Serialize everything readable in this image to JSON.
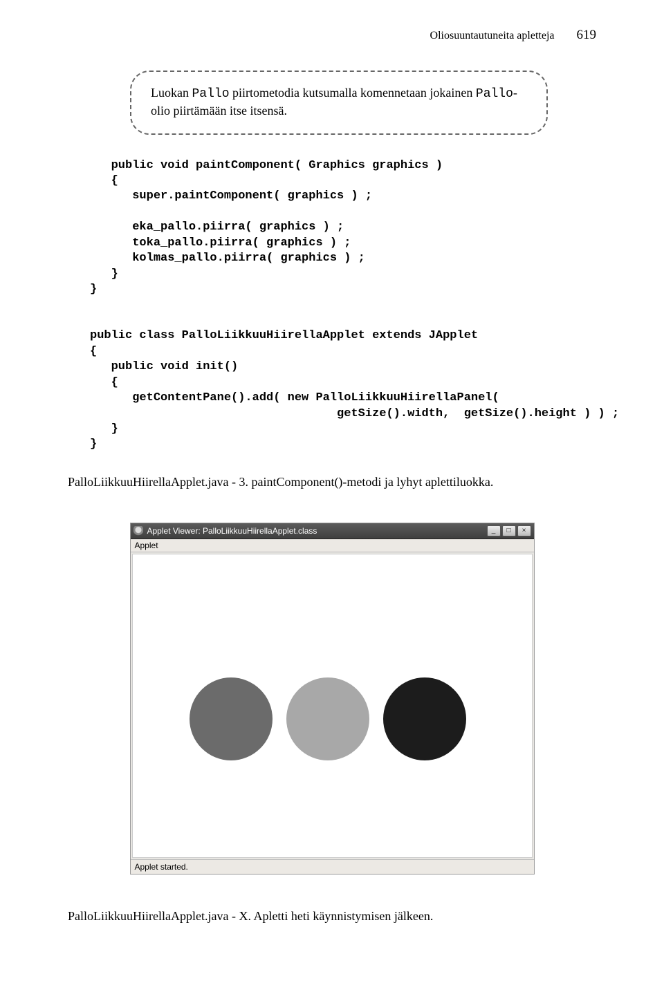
{
  "header": {
    "running_title": "Oliosuuntautuneita apletteja",
    "page_number": "619"
  },
  "callout": {
    "prefix": "Luokan ",
    "code1": "Pallo",
    "mid1": " piirtometodia kutsumalla komennetaan jokainen ",
    "code2": "Pallo",
    "suffix": "-olio piirtämään itse itsensä."
  },
  "code1": "   public void paintComponent( Graphics graphics )\n   {\n      super.paintComponent( graphics ) ;\n\n      eka_pallo.piirra( graphics ) ;\n      toka_pallo.piirra( graphics ) ;\n      kolmas_pallo.piirra( graphics ) ;\n   }\n}\n\n\npublic class PalloLiikkuuHiirellaApplet extends JApplet\n{\n   public void init()\n   {\n      getContentPane().add( new PalloLiikkuuHiirellaPanel(\n                                   getSize().width,  getSize().height ) ) ;\n   }\n}",
  "caption1": {
    "filename": "PalloLiikkuuHiirellaApplet.java - 3.",
    "desc": "  paintComponent()-metodi ja lyhyt aplettiluokka."
  },
  "applet": {
    "title": "Applet Viewer: PalloLiikkuuHiirellaApplet.class",
    "menu": "Applet",
    "status": "Applet started.",
    "min": "_",
    "max": "□",
    "close": "×"
  },
  "caption2": {
    "filename": "PalloLiikkuuHiirellaApplet.java - X.",
    "desc": "  Apletti heti käynnistymisen jälkeen."
  }
}
